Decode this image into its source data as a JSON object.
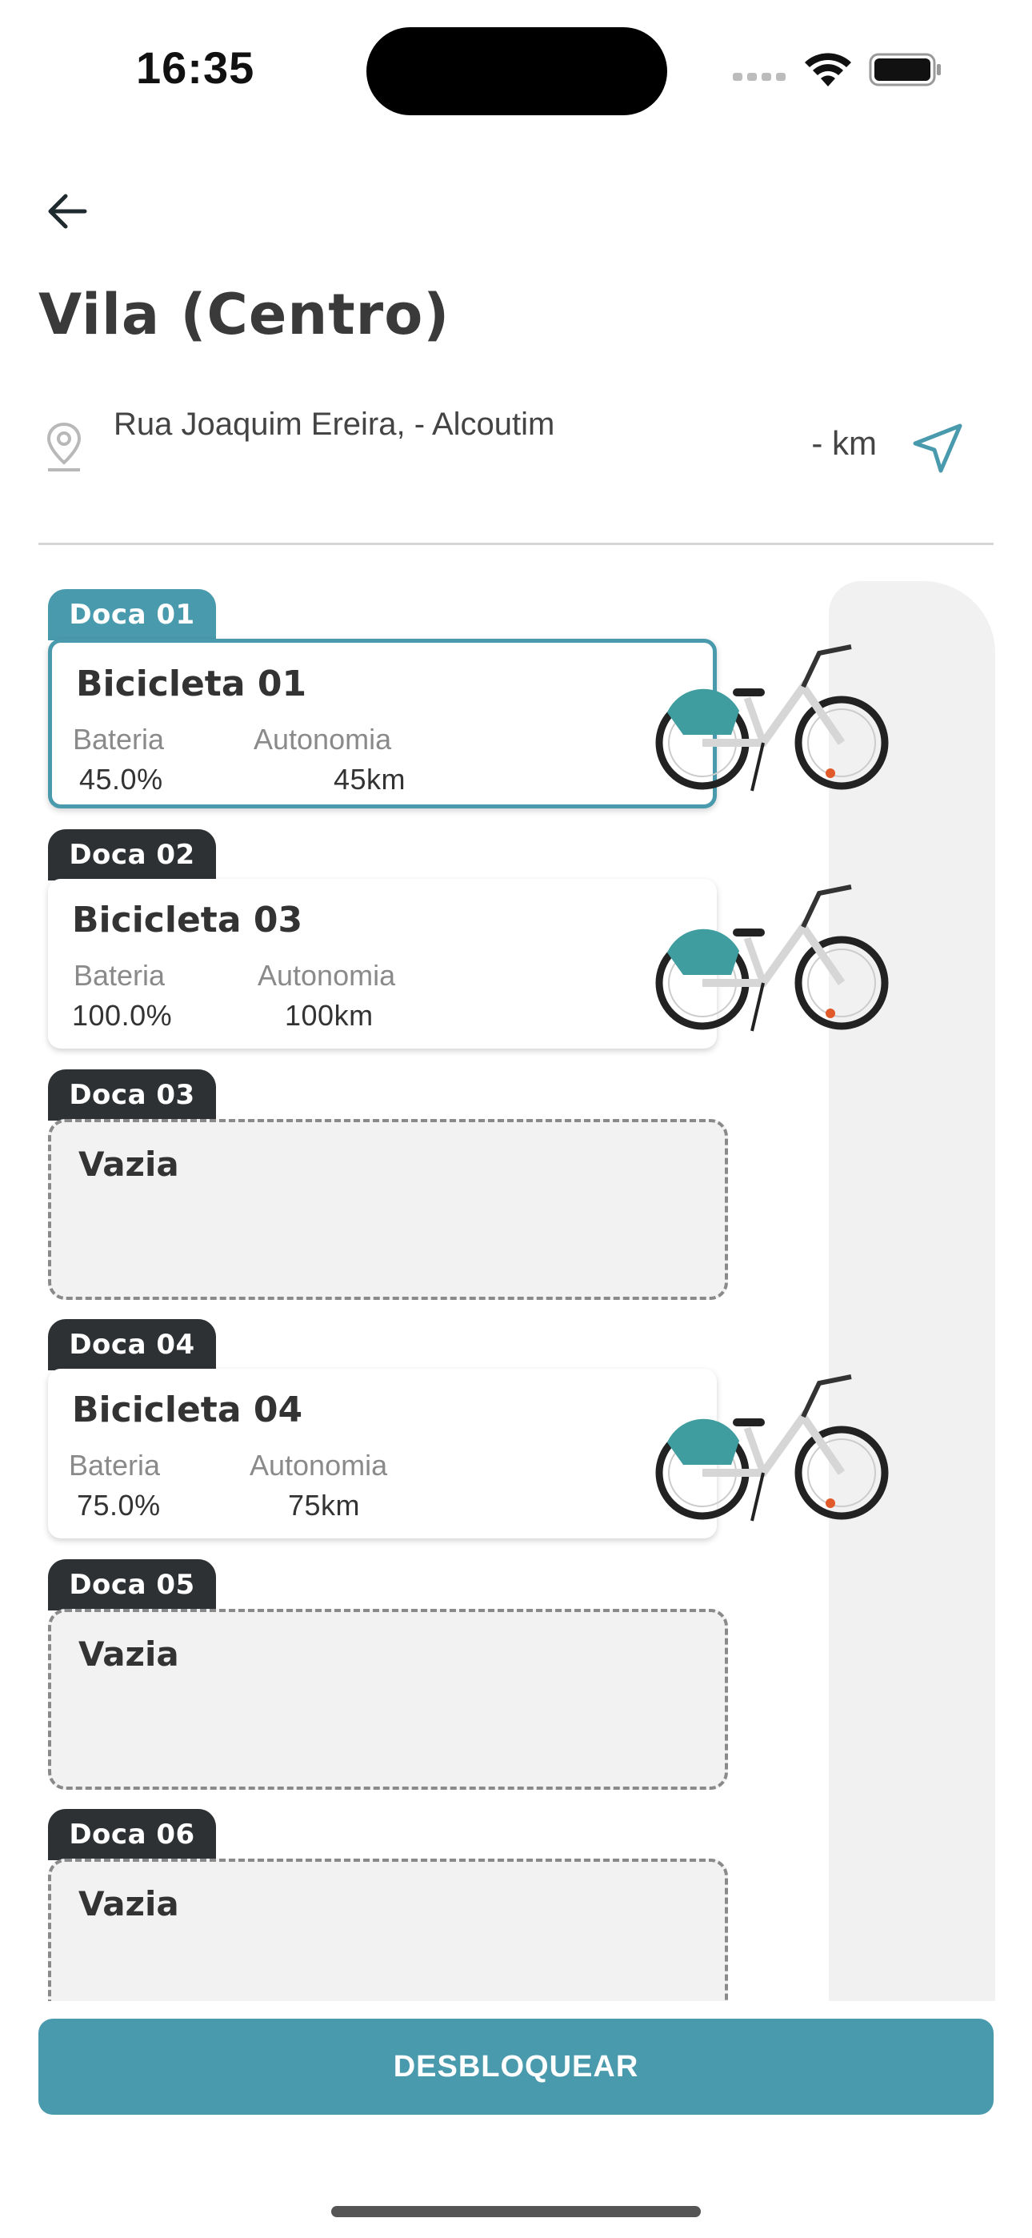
{
  "status_bar": {
    "time": "16:35"
  },
  "header": {
    "title": "Vila (Centro)",
    "address": "Rua Joaquim Ereira, - Alcoutim",
    "distance": "- km"
  },
  "docks": [
    {
      "tab": "Doca 01",
      "selected": true,
      "bike_name": "Bicicleta 01",
      "battery_label": "Bateria",
      "battery": "45.0%",
      "range_label": "Autonomia",
      "range": "45km"
    },
    {
      "tab": "Doca 02",
      "selected": false,
      "bike_name": "Bicicleta 03",
      "battery_label": "Bateria",
      "battery": "100.0%",
      "range_label": "Autonomia",
      "range": "100km"
    },
    {
      "tab": "Doca 03",
      "empty": true,
      "empty_label": "Vazia"
    },
    {
      "tab": "Doca 04",
      "selected": false,
      "bike_name": "Bicicleta 04",
      "battery_label": "Bateria",
      "battery": "75.0%",
      "range_label": "Autonomia",
      "range": "75km"
    },
    {
      "tab": "Doca 05",
      "empty": true,
      "empty_label": "Vazia"
    },
    {
      "tab": "Doca 06",
      "empty": true,
      "empty_label": "Vazia"
    }
  ],
  "actions": {
    "unlock_label": "DESBLOQUEAR"
  },
  "colors": {
    "accent": "#4a9aae",
    "tab_dark": "#2e3133",
    "empty_bg": "#f2f2f2"
  }
}
